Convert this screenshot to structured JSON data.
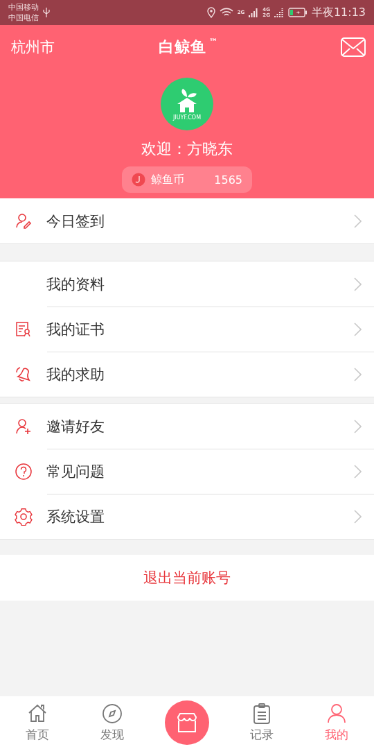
{
  "status_bar": {
    "carriers": [
      "中国移动",
      "中国电信"
    ],
    "network_labels": [
      "2G",
      "4G",
      "2G"
    ],
    "time": "半夜11:13"
  },
  "header": {
    "city": "杭州市",
    "logo": "白鲸鱼",
    "trademark": "™",
    "avatar_caption": "JIUYF.COM",
    "welcome": "欢迎：方晓东",
    "coin_label": "鲸鱼币",
    "coin_amount": "1565"
  },
  "menu_groups": [
    {
      "items": [
        {
          "label": "今日签到"
        }
      ]
    },
    {
      "items": [
        {
          "label": "我的资料"
        },
        {
          "label": "我的证书"
        },
        {
          "label": "我的求助"
        }
      ]
    },
    {
      "items": [
        {
          "label": "邀请好友"
        },
        {
          "label": "常见问题"
        },
        {
          "label": "系统设置"
        }
      ]
    }
  ],
  "logout": "退出当前账号",
  "tab_bar": [
    {
      "kind": "tab",
      "label": "首页",
      "selected": false
    },
    {
      "kind": "tab",
      "label": "发现",
      "selected": false
    },
    {
      "kind": "center"
    },
    {
      "kind": "tab",
      "label": "记录",
      "selected": false
    },
    {
      "kind": "tab",
      "label": "我的",
      "selected": true
    }
  ]
}
